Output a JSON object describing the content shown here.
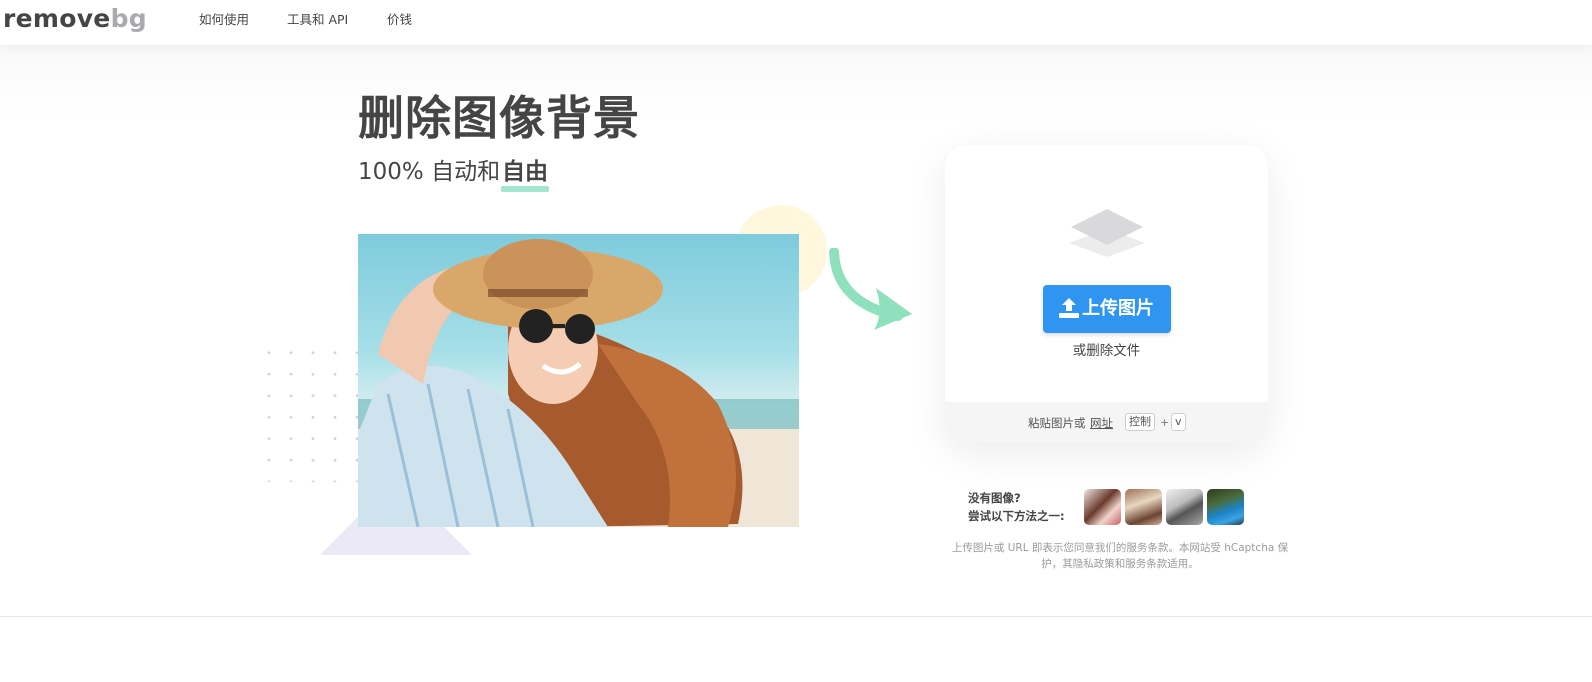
{
  "header": {
    "logo_part1": "remove",
    "logo_part2": "bg",
    "nav": [
      "如何使用",
      "工具和 API",
      "价钱"
    ]
  },
  "hero": {
    "title": "删除图像背景",
    "subtitle_prefix": "100% 自动和",
    "subtitle_accent": "自由"
  },
  "upload_card": {
    "button_label": "上传图片",
    "drop_text": "或删除文件",
    "paste_text": "粘贴图片或",
    "paste_link": "网址",
    "kbd_ctrl": "控制",
    "kbd_plus": "+",
    "kbd_v": "v"
  },
  "samples": {
    "line1": "没有图像?",
    "line2": "尝试以下方法之一:"
  },
  "terms": {
    "text": "上传图片或 URL 即表示您同意我们的服务条款。本网站受 hCaptcha 保护，其隐私政策和服务条款适用。"
  },
  "colors": {
    "primary_button": "#2f95f0",
    "accent_underline": "#a2e7cd",
    "arrow": "#8fe0bd",
    "text": "#454545"
  },
  "icons": {
    "upload": "upload-icon",
    "layers": "layers-icon",
    "arrow": "curved-arrow-icon"
  }
}
